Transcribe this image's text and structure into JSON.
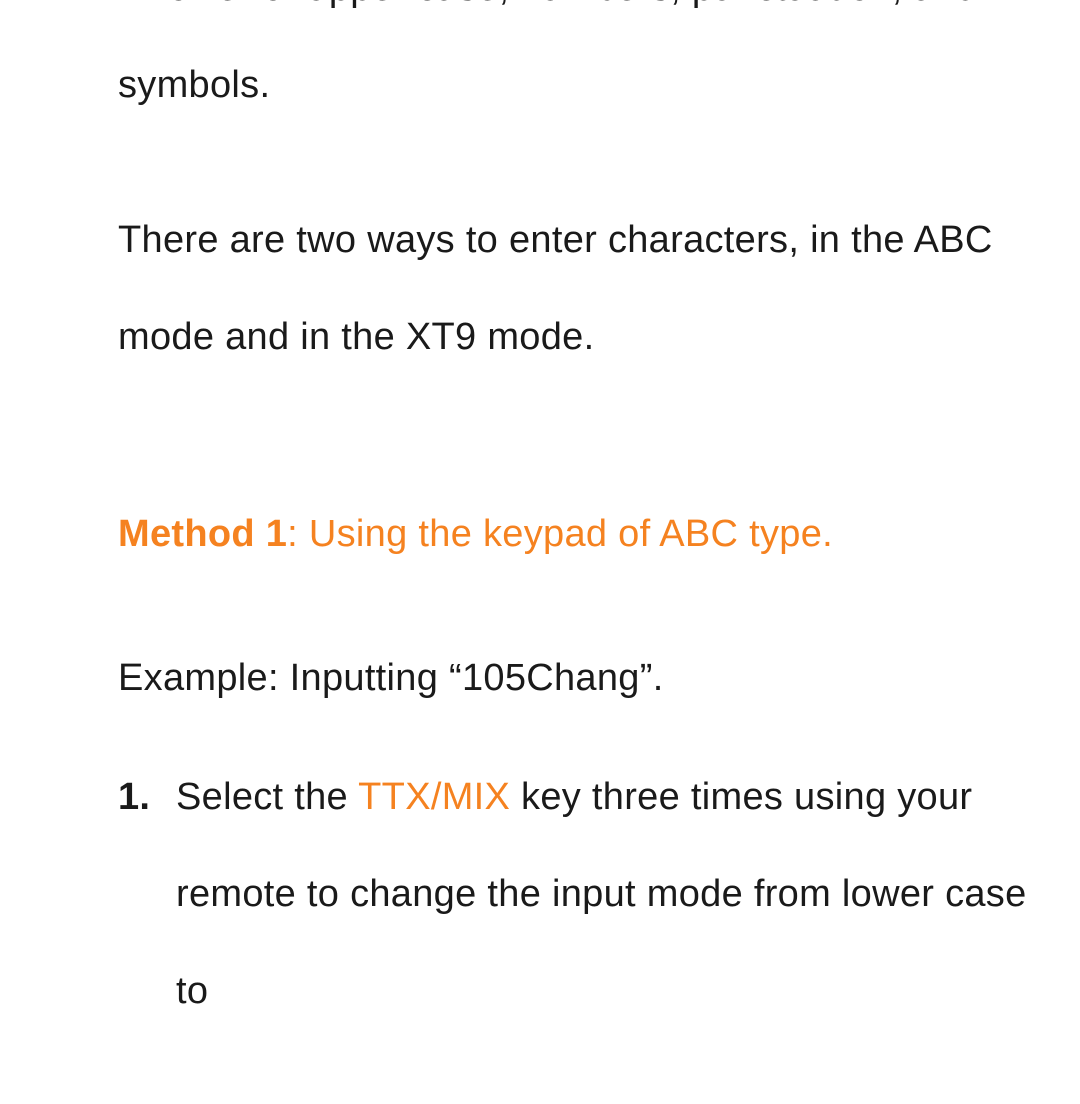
{
  "intro": {
    "line1": "in lower or upper case, numbers, punctuation, and symbols.",
    "line2": "There are two ways to enter characters, in the ABC mode and in the XT9 mode."
  },
  "method": {
    "label": "Method 1",
    "separator": ": ",
    "title_rest": "Using the keypad of ABC type."
  },
  "example": "Example: Inputting “105Chang”.",
  "step1": {
    "marker": "1.",
    "before_key": "Select the ",
    "key_name": "TTX/MIX",
    "after_key": " key three times using your remote to change the input mode from lower case to"
  }
}
